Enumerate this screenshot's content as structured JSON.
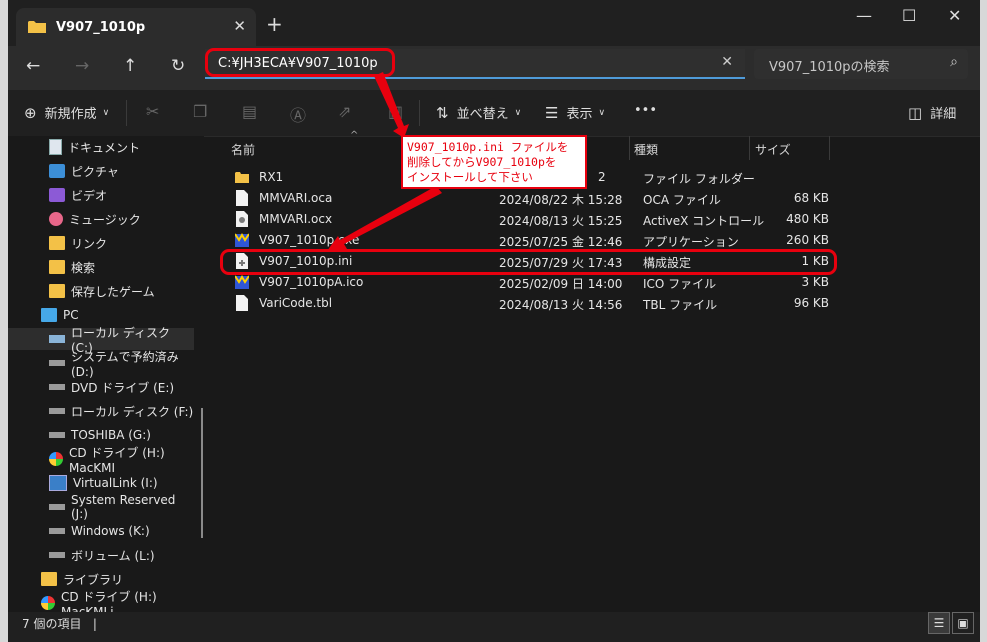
{
  "window": {
    "tab_title": "V907_1010p"
  },
  "address": {
    "path": "C:¥JH3ECA¥V907_1010p"
  },
  "search": {
    "placeholder": "V907_1010pの検索"
  },
  "toolbar": {
    "new_label": "新規作成",
    "sort_label": "並べ替え",
    "view_label": "表示",
    "more_label": "•••",
    "details_label": "詳細"
  },
  "sidebar": {
    "items": [
      {
        "label": "ドキュメント",
        "icon": "document-icon"
      },
      {
        "label": "ピクチャ",
        "icon": "picture-icon"
      },
      {
        "label": "ビデオ",
        "icon": "video-icon"
      },
      {
        "label": "ミュージック",
        "icon": "music-icon"
      },
      {
        "label": "リンク",
        "icon": "folder-icon"
      },
      {
        "label": "検索",
        "icon": "folder-icon"
      },
      {
        "label": "保存したゲーム",
        "icon": "folder-icon"
      },
      {
        "label": "PC",
        "icon": "pc-icon"
      },
      {
        "label": "ローカル ディスク (C:)",
        "icon": "drive-icon"
      },
      {
        "label": "システムで予約済み (D:)",
        "icon": "drive-icon"
      },
      {
        "label": "DVD ドライブ (E:)",
        "icon": "drive-icon"
      },
      {
        "label": "ローカル ディスク (F:)",
        "icon": "drive-icon"
      },
      {
        "label": "TOSHIBA (G:)",
        "icon": "drive-icon"
      },
      {
        "label": "CD ドライブ (H:) MacKMI",
        "icon": "cd-icon"
      },
      {
        "label": "VirtualLink (I:)",
        "icon": "virtual-icon"
      },
      {
        "label": "System Reserved (J:)",
        "icon": "drive-icon"
      },
      {
        "label": "Windows (K:)",
        "icon": "drive-icon"
      },
      {
        "label": "ボリューム (L:)",
        "icon": "drive-icon"
      },
      {
        "label": "ライブラリ",
        "icon": "folder-icon"
      },
      {
        "label": "CD ドライブ (H:) MacKMLi",
        "icon": "cd-icon"
      }
    ]
  },
  "columns": {
    "name": "名前",
    "date": "",
    "type": "種類",
    "size": "サイズ"
  },
  "files": [
    {
      "name": "RX1",
      "date": "2",
      "type": "ファイル フォルダー",
      "size": ""
    },
    {
      "name": "MMVARI.oca",
      "date": "2024/08/22 木 15:28",
      "type": "OCA ファイル",
      "size": "68 KB"
    },
    {
      "name": "MMVARI.ocx",
      "date": "2024/08/13 火 15:25",
      "type": "ActiveX コントロール",
      "size": "480 KB"
    },
    {
      "name": "V907_1010p.exe",
      "date": "2025/07/25 金 12:46",
      "type": "アプリケーション",
      "size": "260 KB"
    },
    {
      "name": "V907_1010p.ini",
      "date": "2025/07/29 火 17:43",
      "type": "構成設定",
      "size": "1 KB"
    },
    {
      "name": "V907_1010pA.ico",
      "date": "2025/02/09 日 14:00",
      "type": "ICO ファイル",
      "size": "3 KB"
    },
    {
      "name": "VariCode.tbl",
      "date": "2024/08/13 火 14:56",
      "type": "TBL ファイル",
      "size": "96 KB"
    }
  ],
  "status": {
    "count": "7 個の項目",
    "cursor": "|"
  },
  "annotation": {
    "line1": "V907_1010p.ini ファイルを",
    "line2": "削除してからV907_1010pを",
    "line3": "インストールして下さい"
  },
  "colors": {
    "accent": "#4f9bd9",
    "annotation": "#e8000e",
    "folder": "#f3c147"
  }
}
